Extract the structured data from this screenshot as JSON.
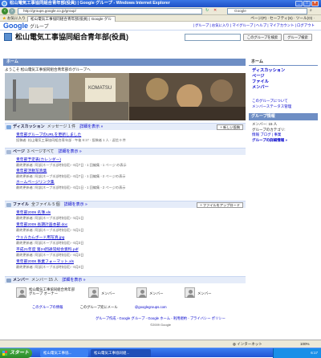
{
  "window": {
    "title": "松山電気工事協同組合青年部(役員) | Google グループ - Windows Internet Explorer",
    "min": "_",
    "max": "□",
    "close": "×"
  },
  "address": {
    "url": "http://groups.google.co.jp/group/",
    "search": "Google"
  },
  "favbar": {
    "star": "お気に入り",
    "tab": "松山電気工事協同組合青年部(役員) | Google グル",
    "tools": "ページ(P) · セーフティ(S) · ツール(O) ·"
  },
  "gbar": {
    "logo": "Google",
    "grp": "グループ",
    "links": "| グループ | お気に入り | マイグループ | ヘルプ | マイアカウント | ログアウト"
  },
  "group": {
    "title": "松山電気工事協同組合青年部(役員)",
    "btn1": "このグループを検索",
    "btn2": "グループ検索"
  },
  "home": {
    "label": "ホーム",
    "welcome": "ようこそ 松山電気工事協同組合青年部のグループへ"
  },
  "sections": {
    "disc": {
      "title": "ディスカッション",
      "count": "メッセージ 1 件",
      "detail": "詳細を表示 »",
      "button": "+ 新しい投稿"
    },
    "pages": {
      "title": "ページ",
      "count": "3 ページすべて",
      "detail": "詳細を表示 »"
    },
    "files": {
      "title": "ファイル",
      "count": "全ファイル 5 個",
      "detail": "詳細を表示 »",
      "button": "+ ファイルをアップロード"
    },
    "members": {
      "title": "メンバー",
      "count": "メンバー 15 人",
      "detail": "詳細を表示 »"
    }
  },
  "disc_items": [
    {
      "title": "青年部グループのURLを更新しました",
      "meta": "投稿者: 松山電気工事協同組合青年部 - 午後 6:17 - 投稿者 1 人 - 返信 0 件"
    }
  ],
  "page_items": [
    {
      "title": "青年部予定表(カレンダー)",
      "meta": "最終更新者: 阿部(ネーブ水)(時刻(初) - 6月7日 - 1 回編集 - 1 ページ の表示"
    },
    {
      "title": "青年部活動写真集",
      "meta": "最終更新者: 阿部(ネーブ水)(時刻(初) - 6月7日 - 1 回編集 - 2 ページの表示"
    },
    {
      "title": "ホームページリンク集",
      "meta": "最終更新者: 阿部(ネーブ水)(時刻(初) - 6月1日 - 1 回編集 - 2 ページの表示"
    }
  ],
  "file_items": [
    {
      "title": "青年部2009 名簿.xls",
      "meta": "最終更新者: 阿部(ネーブ水)(時刻(初) - 5月1日"
    },
    {
      "title": "青年部2009 長期計画本部.doc",
      "meta": "最終更新者: 阿部(ネーブ水)(時刻(初) - 5月1日"
    },
    {
      "title": "ウェルカムボード用写真.jpg",
      "meta": "最終更新者: 阿部(ネーブ水)(時刻(初) - 6月3日"
    },
    {
      "title": "平成21年度 第24回通常総会資料.pdf",
      "meta": "最終更新者: 阿部(ネーブ水)(時刻(初) - 6月3日"
    },
    {
      "title": "青年部2008 事業フォーマット.xls",
      "meta": "最終更新者: 阿部(ネーブ水)(時刻(初) - 6月4日"
    }
  ],
  "members": [
    {
      "name": "松山電気工事協同組合青年部 グループ オーナー"
    },
    {
      "name": "メンバー"
    },
    {
      "name": "メンバー"
    },
    {
      "name": "メンバー"
    }
  ],
  "footer_links": {
    "about": "このグループの情報",
    "report": "このグループ宛にメール",
    "email": "@googlegroups.com"
  },
  "footer": {
    "links": "グループ作成 - Google グループ - Google ホーム - 利用規約 - プライバシー ポリシー",
    "copy": "©2009 Google"
  },
  "sidebar": {
    "home": "ホーム",
    "items": [
      "ディスカッション",
      "ページ",
      "ファイル",
      "メンバー"
    ],
    "links": [
      "このグループについて",
      "メンバーステータス管理"
    ],
    "info_head": "グループ情報",
    "info": [
      "メンバー: 15 人",
      "グループのカテゴリ:",
      "情報 ブログ | 事業",
      "グループの詳細情報 »"
    ]
  },
  "status": {
    "left": "",
    "zone": "インターネット",
    "zoom": "100%"
  },
  "taskbar": {
    "start": "スタート",
    "task1": "松山電気工事協...",
    "task2": "松山電気工事協同組...",
    "clock": "6:17"
  }
}
